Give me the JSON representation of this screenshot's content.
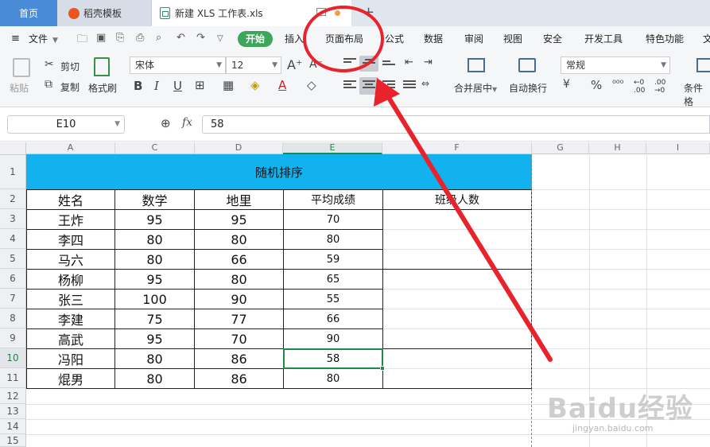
{
  "tabs": {
    "home": "首页",
    "template": "稻壳模板",
    "document": "新建 XLS 工作表.xls"
  },
  "menu": {
    "file": "文件",
    "start": "开始",
    "items": [
      "插入",
      "页面布局",
      "公式",
      "数据",
      "审阅",
      "视图",
      "安全",
      "开发工具",
      "特色功能",
      "文"
    ]
  },
  "ribbon": {
    "paste": "粘贴",
    "cut": "剪切",
    "copy": "复制",
    "format_painter": "格式刷",
    "font_name": "宋体",
    "font_size": "12",
    "merge_center": "合并居中",
    "wrap_text": "自动换行",
    "number_format": "常规",
    "conditional_format": "条件格"
  },
  "formula_bar": {
    "name_box": "E10",
    "fx": "fx",
    "value": "58"
  },
  "columns": [
    "A",
    "C",
    "D",
    "E",
    "F",
    "G",
    "H",
    "I"
  ],
  "rows": [
    "1",
    "2",
    "3",
    "4",
    "5",
    "6",
    "7",
    "8",
    "9",
    "10",
    "11",
    "12",
    "13",
    "14",
    "15"
  ],
  "table": {
    "title": "随机排序",
    "headers": [
      "姓名",
      "数学",
      "地里",
      "平均成绩",
      "班级人数"
    ],
    "data": [
      [
        "王炸",
        "95",
        "95",
        "70"
      ],
      [
        "李四",
        "80",
        "80",
        "80"
      ],
      [
        "马六",
        "80",
        "66",
        "59"
      ],
      [
        "杨柳",
        "95",
        "80",
        "65"
      ],
      [
        "张三",
        "100",
        "90",
        "55"
      ],
      [
        "李建",
        "75",
        "77",
        "66"
      ],
      [
        "高武",
        "95",
        "70",
        "90"
      ],
      [
        "冯阳",
        "80",
        "86",
        "58"
      ],
      [
        "焜男",
        "80",
        "86",
        "80"
      ]
    ]
  },
  "watermark": {
    "main": "Baidu经验",
    "sub": "jingyan.baidu.com"
  },
  "colors": {
    "title_fill": "#12b2ee",
    "annotation": "#e8232b",
    "active": "#1e8a47"
  }
}
